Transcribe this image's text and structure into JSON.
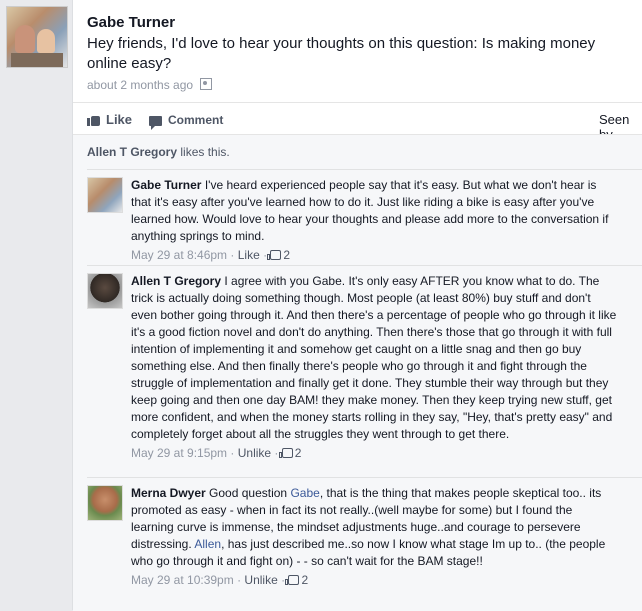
{
  "post": {
    "author": "Gabe Turner",
    "text": "Hey friends, I'd love to hear your thoughts on this question: Is making money online easy?",
    "time": "about 2 months ago"
  },
  "actions": {
    "like": "Like",
    "comment": "Comment",
    "seen": "Seen by"
  },
  "likes": {
    "name": "Allen T Gregory",
    "suffix": " likes this."
  },
  "comments": [
    {
      "author": "Gabe Turner",
      "text": "I've heard experienced people say that it's easy. But what we don't hear is that it's easy after you've learned how to do it. Just like riding a bike is easy after you've learned how. Would love to hear your thoughts and please add more to the conversation if anything springs to mind.",
      "time": "May 29 at 8:46pm",
      "like_label": "Like",
      "like_count": "2"
    },
    {
      "author": "Allen T Gregory",
      "text": "I agree with you Gabe. It's only easy AFTER you know what to do. The trick is actually doing something though. Most people (at least 80%) buy stuff and don't even bother going through it. And then there's a percentage of people who go through it like it's a good fiction novel and don't do anything. Then there's those that go through it with full intention of implementing it and somehow get caught on a little snag and then go buy something else. And then finally there's people who go through it and fight through the struggle of implementation and finally get it done. They stumble their way through but they keep going and then one day BAM! they make money. Then they keep trying new stuff, get more confident, and when the money starts rolling in they say, \"Hey, that's pretty easy\" and completely forget about all the struggles they went through to get there.",
      "time": "May 29 at 9:15pm",
      "like_label": "Unlike",
      "like_count": "2"
    },
    {
      "author": "Merna Dwyer",
      "text_a": "Good question ",
      "mention_1": "Gabe",
      "text_b": ", that is the thing that makes people skeptical too.. its promoted as easy - when in fact its not really..(well maybe for some) but I found the learning curve is immense, the mindset adjustments huge..and courage to persevere distressing. ",
      "mention_2": "Allen",
      "text_c": ", has just described me..so now I know what stage Im up to.. (the people who go through it and fight on) - - so can't wait for the BAM stage!!",
      "time": "May 29 at 10:39pm",
      "like_label": "Unlike",
      "like_count": "2"
    }
  ],
  "separator": " · "
}
